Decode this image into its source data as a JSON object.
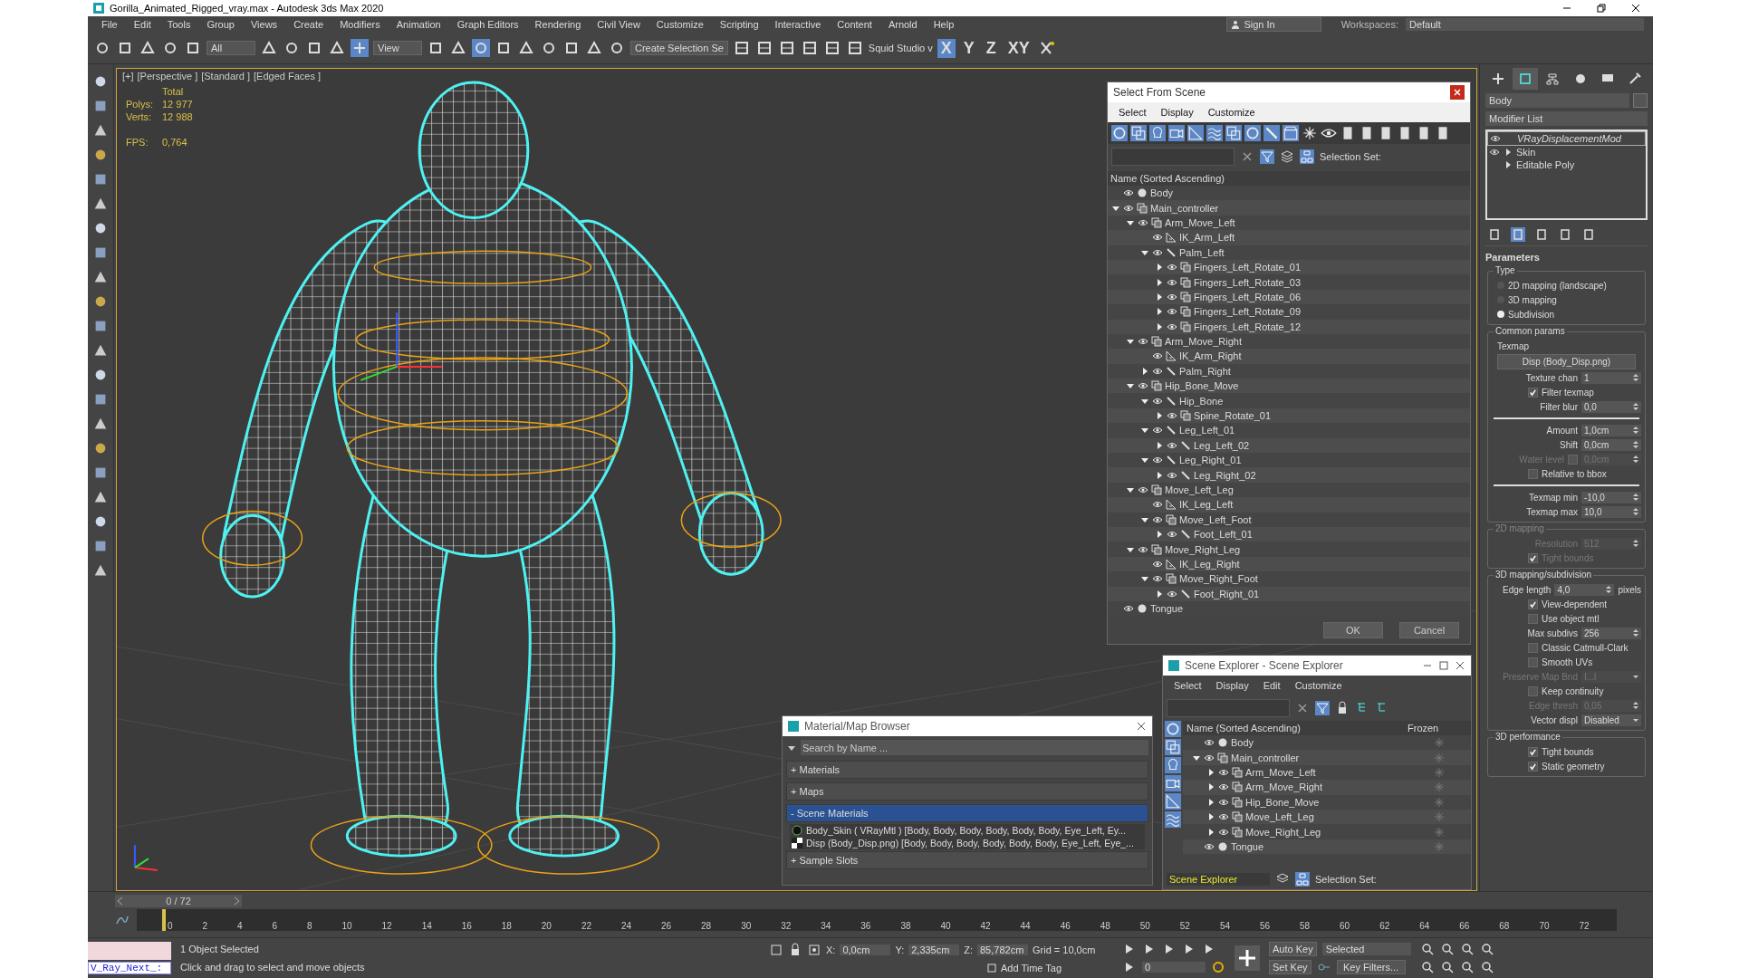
{
  "window": {
    "title": "Gorilla_Animated_Rigged_vray.max - Autodesk 3ds Max 2020"
  },
  "menu": [
    "File",
    "Edit",
    "Tools",
    "Group",
    "Views",
    "Create",
    "Modifiers",
    "Animation",
    "Graph Editors",
    "Rendering",
    "Civil View",
    "Customize",
    "Scripting",
    "Interactive",
    "Content",
    "Arnold",
    "Help"
  ],
  "sign_in": "Sign In",
  "workspaces": {
    "label": "Workspaces:",
    "value": "Default"
  },
  "toolbar": {
    "selection_filter": "All",
    "reference": "View",
    "named_selection": "Create Selection Se",
    "squid": "Squid Studio v",
    "axes": [
      {
        "label": "X",
        "selected": true
      },
      {
        "label": "Y",
        "selected": false
      },
      {
        "label": "Z",
        "selected": false
      },
      {
        "label": "XY",
        "selected": false
      }
    ]
  },
  "viewport": {
    "labels": [
      "[+]",
      "[Perspective ]",
      "[Standard ]",
      "[Edged Faces ]"
    ],
    "stats": {
      "total": "Total",
      "polys_label": "Polys:",
      "polys": "12 977",
      "verts_label": "Verts:",
      "verts": "12 988",
      "fps_label": "FPS:",
      "fps": "0,764"
    }
  },
  "select_from_scene": {
    "title": "Select From Scene",
    "menu": [
      "Select",
      "Display",
      "Customize"
    ],
    "filters": [
      {
        "kind": "geometry",
        "selected": true
      },
      {
        "kind": "helper",
        "selected": true
      },
      {
        "kind": "light",
        "selected": true
      },
      {
        "kind": "camera",
        "selected": true
      },
      {
        "kind": "ik",
        "selected": true
      },
      {
        "kind": "spacewarp",
        "selected": true
      },
      {
        "kind": "group",
        "selected": true
      },
      {
        "kind": "xref",
        "selected": true
      },
      {
        "kind": "bone",
        "selected": true
      },
      {
        "kind": "container",
        "selected": true
      },
      {
        "kind": "frozen",
        "selected": false
      },
      {
        "kind": "hidden",
        "selected": false
      }
    ],
    "selection_set": "Selection Set:",
    "column": "Name (Sorted Ascending)",
    "tree": [
      {
        "name": "Body",
        "kind": "geometry"
      },
      {
        "name": "Main_controller",
        "kind": "helper",
        "expanded": true,
        "children": [
          {
            "name": "Arm_Move_Left",
            "kind": "helper",
            "expanded": true,
            "children": [
              {
                "name": "IK_Arm_Left",
                "kind": "ik"
              },
              {
                "name": "Palm_Left",
                "kind": "bone",
                "expanded": true,
                "children": [
                  {
                    "name": "Fingers_Left_Rotate_01",
                    "kind": "helper",
                    "expanded": false
                  },
                  {
                    "name": "Fingers_Left_Rotate_03",
                    "kind": "helper",
                    "expanded": false
                  },
                  {
                    "name": "Fingers_Left_Rotate_06",
                    "kind": "helper",
                    "expanded": false
                  },
                  {
                    "name": "Fingers_Left_Rotate_09",
                    "kind": "helper",
                    "expanded": false
                  },
                  {
                    "name": "Fingers_Left_Rotate_12",
                    "kind": "helper",
                    "expanded": false
                  }
                ]
              }
            ]
          },
          {
            "name": "Arm_Move_Right",
            "kind": "helper",
            "expanded": true,
            "children": [
              {
                "name": "IK_Arm_Right",
                "kind": "ik"
              },
              {
                "name": "Palm_Right",
                "kind": "bone",
                "expanded": false
              }
            ]
          },
          {
            "name": "Hip_Bone_Move",
            "kind": "helper",
            "expanded": true,
            "children": [
              {
                "name": "Hip_Bone",
                "kind": "bone",
                "expanded": true,
                "children": [
                  {
                    "name": "Spine_Rotate_01",
                    "kind": "helper",
                    "expanded": false
                  }
                ]
              },
              {
                "name": "Leg_Left_01",
                "kind": "bone",
                "expanded": true,
                "children": [
                  {
                    "name": "Leg_Left_02",
                    "kind": "bone",
                    "expanded": false
                  }
                ]
              },
              {
                "name": "Leg_Right_01",
                "kind": "bone",
                "expanded": true,
                "children": [
                  {
                    "name": "Leg_Right_02",
                    "kind": "bone",
                    "expanded": false
                  }
                ]
              }
            ]
          },
          {
            "name": "Move_Left_Leg",
            "kind": "helper",
            "expanded": true,
            "children": [
              {
                "name": "IK_Leg_Left",
                "kind": "ik"
              },
              {
                "name": "Move_Left_Foot",
                "kind": "helper",
                "expanded": true,
                "children": [
                  {
                    "name": "Foot_Left_01",
                    "kind": "bone",
                    "expanded": false
                  }
                ]
              }
            ]
          },
          {
            "name": "Move_Right_Leg",
            "kind": "helper",
            "expanded": true,
            "children": [
              {
                "name": "IK_Leg_Right",
                "kind": "ik"
              },
              {
                "name": "Move_Right_Foot",
                "kind": "helper",
                "expanded": true,
                "children": [
                  {
                    "name": "Foot_Right_01",
                    "kind": "bone",
                    "expanded": false
                  }
                ]
              }
            ]
          }
        ]
      },
      {
        "name": "Tongue",
        "kind": "geometry"
      }
    ],
    "buttons": [
      "OK",
      "Cancel"
    ]
  },
  "material_browser": {
    "title": "Material/Map Browser",
    "placeholder": "Search by Name ...",
    "groups": [
      {
        "sign": "+",
        "label": "Materials",
        "selected": false
      },
      {
        "sign": "+",
        "label": "Maps",
        "selected": false
      },
      {
        "sign": "-",
        "label": "Scene Materials",
        "selected": true,
        "items": [
          {
            "kind": "material",
            "text": "Body_Skin  ( VRayMtl ) [Body, Body, Body, Body, Body, Body, Eye_Left, Ey..."
          },
          {
            "kind": "map",
            "text": "Disp (Body_Disp.png) [Body, Body, Body, Body, Body, Body, Eye_Left, Eye_..."
          }
        ]
      },
      {
        "sign": "+",
        "label": "Sample Slots",
        "selected": false
      }
    ]
  },
  "scene_explorer": {
    "title": "Scene Explorer - Scene Explorer",
    "menu": [
      "Select",
      "Display",
      "Edit",
      "Customize"
    ],
    "filters": [
      {
        "kind": "geometry",
        "selected": true
      },
      {
        "kind": "helper",
        "selected": true
      },
      {
        "kind": "light",
        "selected": true
      },
      {
        "kind": "camera",
        "selected": true
      },
      {
        "kind": "ik",
        "selected": true
      },
      {
        "kind": "spacewarp",
        "selected": true
      }
    ],
    "columns": [
      "Name (Sorted Ascending)",
      "Frozen"
    ],
    "tree": [
      {
        "name": "Body",
        "kind": "geometry"
      },
      {
        "name": "Main_controller",
        "kind": "helper",
        "expanded": true,
        "children": [
          {
            "name": "Arm_Move_Left",
            "kind": "helper",
            "expanded": false
          },
          {
            "name": "Arm_Move_Right",
            "kind": "helper",
            "expanded": false
          },
          {
            "name": "Hip_Bone_Move",
            "kind": "helper",
            "expanded": false
          },
          {
            "name": "Move_Left_Leg",
            "kind": "helper",
            "expanded": false
          },
          {
            "name": "Move_Right_Leg",
            "kind": "helper",
            "expanded": false
          }
        ]
      },
      {
        "name": "Tongue",
        "kind": "geometry"
      }
    ],
    "explorer": "Scene Explorer",
    "selection_set": "Selection Set:"
  },
  "command_panel": {
    "tabs": [
      {
        "kind": "create",
        "selected": false
      },
      {
        "kind": "modify",
        "selected": true
      },
      {
        "kind": "hierarchy",
        "selected": false
      },
      {
        "kind": "motion",
        "selected": false
      },
      {
        "kind": "display",
        "selected": false
      },
      {
        "kind": "utilities",
        "selected": false
      }
    ],
    "object_name": "Body",
    "modifier_list": "Modifier List",
    "stack": [
      {
        "label": "VRayDisplacementMod",
        "eye": true,
        "selected": true
      },
      {
        "label": "Skin",
        "eye": true,
        "expanded": false,
        "selected": false
      },
      {
        "label": "Editable Poly",
        "eye": false,
        "expanded": false,
        "selected": false
      }
    ],
    "parameters": {
      "title": "Parameters",
      "groups": [
        {
          "title": "Type",
          "disabled": false,
          "controls": [
            {
              "kind": "radio",
              "label": "2D mapping (landscape)",
              "selected": false,
              "disabled": false
            },
            {
              "kind": "radio",
              "label": "3D mapping",
              "selected": false,
              "disabled": false
            },
            {
              "kind": "radio",
              "label": "Subdivision",
              "selected": true,
              "disabled": false
            }
          ]
        },
        {
          "title": "Common params",
          "disabled": false,
          "controls": [
            {
              "kind": "label",
              "label": "Texmap",
              "disabled": false
            },
            {
              "kind": "button",
              "label": "Disp (Body_Disp.png)",
              "disabled": false
            },
            {
              "kind": "spinner",
              "label": "Texture chan",
              "value": "1",
              "disabled": false
            },
            {
              "kind": "checkbox",
              "label": "Filter texmap",
              "checked": true,
              "disabled": false
            },
            {
              "kind": "spinner",
              "label": "Filter blur",
              "value": "0,0",
              "disabled": false
            },
            {
              "kind": "separator"
            },
            {
              "kind": "spinner",
              "label": "Amount",
              "value": "1,0cm",
              "disabled": false
            },
            {
              "kind": "spinner",
              "label": "Shift",
              "value": "0,0cm",
              "disabled": false
            },
            {
              "kind": "check_spinner",
              "label": "Water level",
              "checked": false,
              "value": "0,0cm",
              "disabled": true
            },
            {
              "kind": "checkbox",
              "label": "Relative to bbox",
              "checked": false,
              "disabled": false
            },
            {
              "kind": "separator"
            },
            {
              "kind": "spinner",
              "label": "Texmap min",
              "value": "-10,0",
              "disabled": false
            },
            {
              "kind": "spinner",
              "label": "Texmap max",
              "value": "10,0",
              "disabled": false
            }
          ]
        },
        {
          "title": "2D mapping",
          "disabled": true,
          "controls": [
            {
              "kind": "spinner",
              "label": "Resolution",
              "value": "512",
              "disabled": true
            },
            {
              "kind": "checkbox",
              "label": "Tight bounds",
              "checked": true,
              "disabled": true
            }
          ]
        },
        {
          "title": "3D mapping/subdivision",
          "disabled": false,
          "controls": [
            {
              "kind": "spinner",
              "label": "Edge length",
              "value": "4,0",
              "suffix": "pixels",
              "disabled": false
            },
            {
              "kind": "checkbox",
              "label": "View-dependent",
              "checked": true,
              "disabled": false
            },
            {
              "kind": "checkbox",
              "label": "Use object mtl",
              "checked": false,
              "disabled": false
            },
            {
              "kind": "spinner",
              "label": "Max subdivs",
              "value": "256",
              "disabled": false
            },
            {
              "kind": "checkbox",
              "label": "Classic Catmull-Clark",
              "checked": false,
              "disabled": false
            },
            {
              "kind": "checkbox",
              "label": "Smooth UVs",
              "checked": false,
              "disabled": false
            },
            {
              "kind": "dropdown",
              "label": "Preserve Map Bnd",
              "value": "I...l",
              "disabled": true
            },
            {
              "kind": "checkbox",
              "label": "Keep continuity",
              "checked": false,
              "disabled": false
            },
            {
              "kind": "spinner",
              "label": "Edge thresh",
              "value": "0,05",
              "disabled": true
            },
            {
              "kind": "dropdown",
              "label": "Vector displ",
              "value": "Disabled",
              "disabled": false
            }
          ]
        },
        {
          "title": "3D performance",
          "disabled": false,
          "controls": [
            {
              "kind": "checkbox",
              "label": "Tight bounds",
              "checked": true,
              "disabled": false
            },
            {
              "kind": "checkbox",
              "label": "Static geometry",
              "checked": true,
              "disabled": false
            }
          ]
        }
      ]
    }
  },
  "timeline": {
    "slider": "0 / 72",
    "ticks": [
      "0",
      "2",
      "4",
      "6",
      "8",
      "10",
      "12",
      "14",
      "16",
      "18",
      "20",
      "22",
      "24",
      "26",
      "28",
      "30",
      "32",
      "34",
      "36",
      "38",
      "40",
      "42",
      "44",
      "46",
      "48",
      "50",
      "52",
      "54",
      "56",
      "58",
      "60",
      "62",
      "64",
      "66",
      "68",
      "70",
      "72"
    ]
  },
  "status": {
    "maxscript": "V_Ray_Next_:",
    "selected": "1 Object Selected",
    "prompt": "Click and drag to select and move objects",
    "x_label": "X:",
    "x": "0,0cm",
    "y_label": "Y:",
    "y": "2,335cm",
    "z_label": "Z:",
    "z": "85,782cm",
    "grid": "Grid = 10,0cm",
    "time_tag": "Add Time Tag",
    "auto_key": "Auto Key",
    "key_mode": "Selected",
    "set_key": "Set Key",
    "key_filters": "Key Filters...",
    "frame": "0"
  }
}
